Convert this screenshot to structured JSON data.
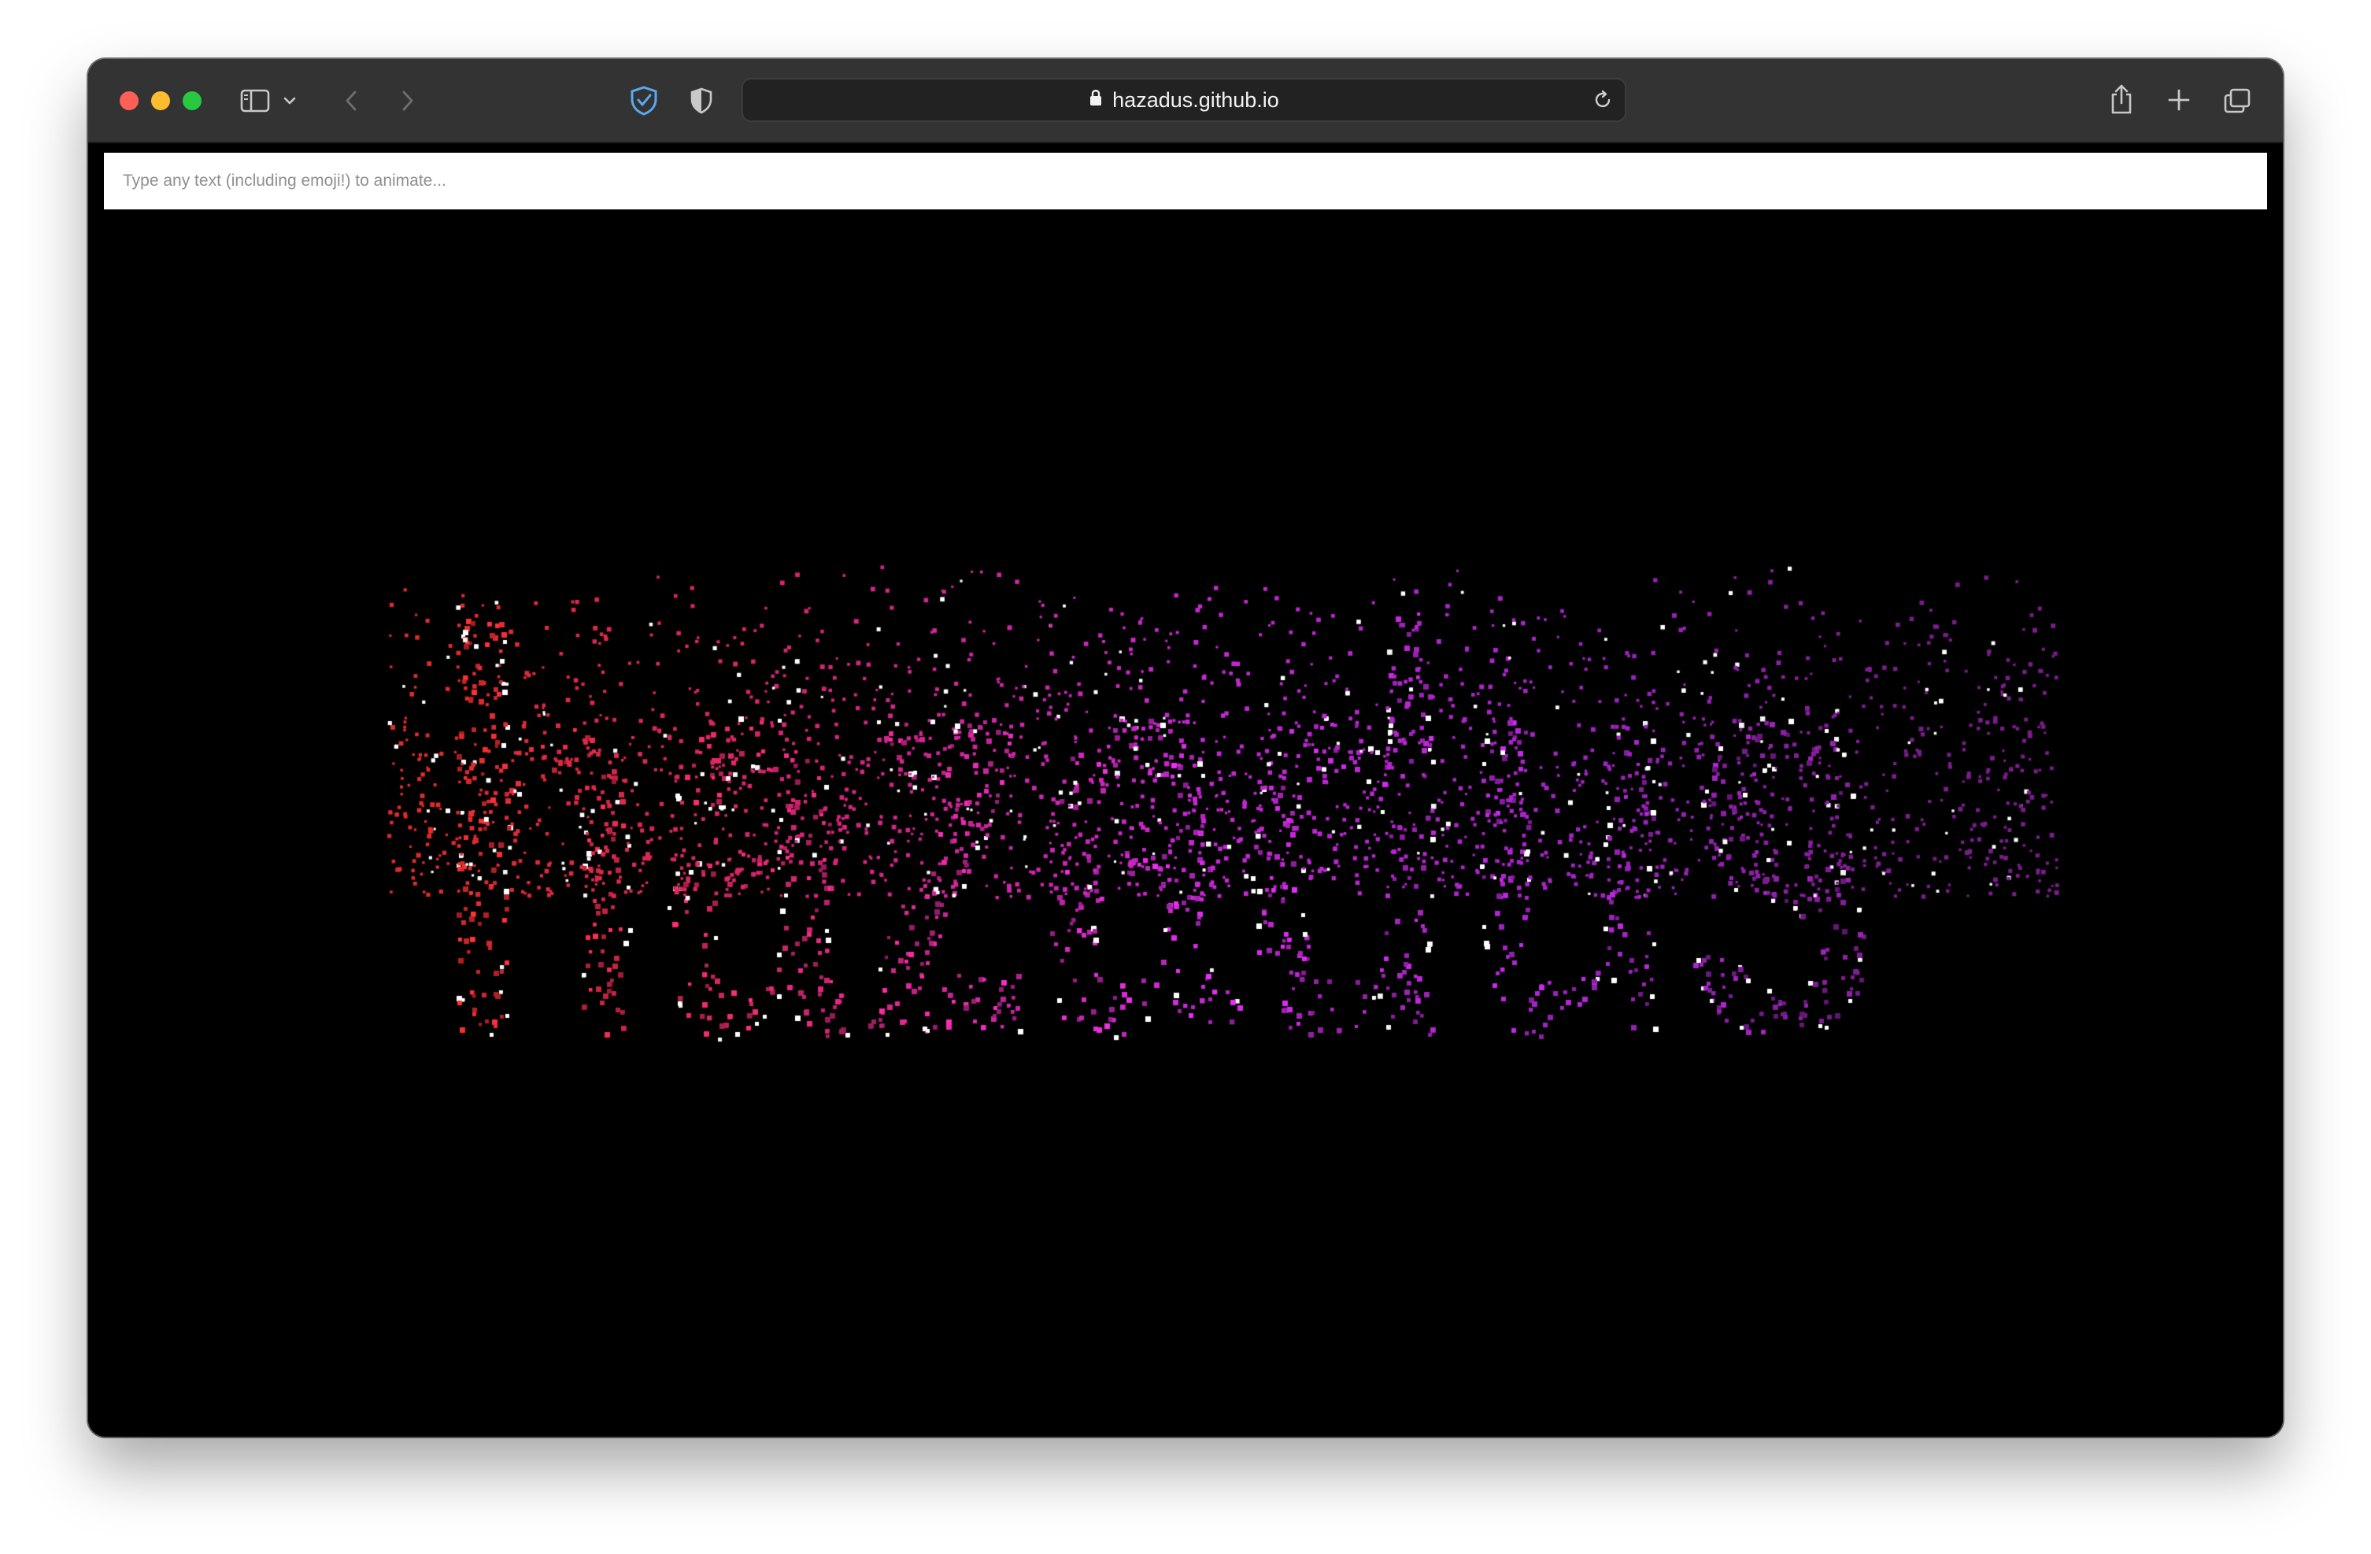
{
  "browser": {
    "url": "hazadus.github.io",
    "traffic_lights": {
      "close": "#ff5f57",
      "minimize": "#febc2e",
      "zoom": "#28c840"
    },
    "icons": [
      "sidebar-icon",
      "chevron-down-icon",
      "back-icon",
      "forward-icon",
      "shield-check-icon",
      "privacy-shield-icon",
      "lock-icon",
      "reload-icon",
      "share-icon",
      "new-tab-icon",
      "tab-overview-icon"
    ]
  },
  "page": {
    "input_placeholder": "Type any text (including emoji!) to animate...",
    "input_value": "",
    "animated_text": "hazadus",
    "gradient_colors": [
      "#e02b2b",
      "#d5257a",
      "#c927d6",
      "#a524c8",
      "#7a1c8c"
    ],
    "background": "#000000"
  }
}
